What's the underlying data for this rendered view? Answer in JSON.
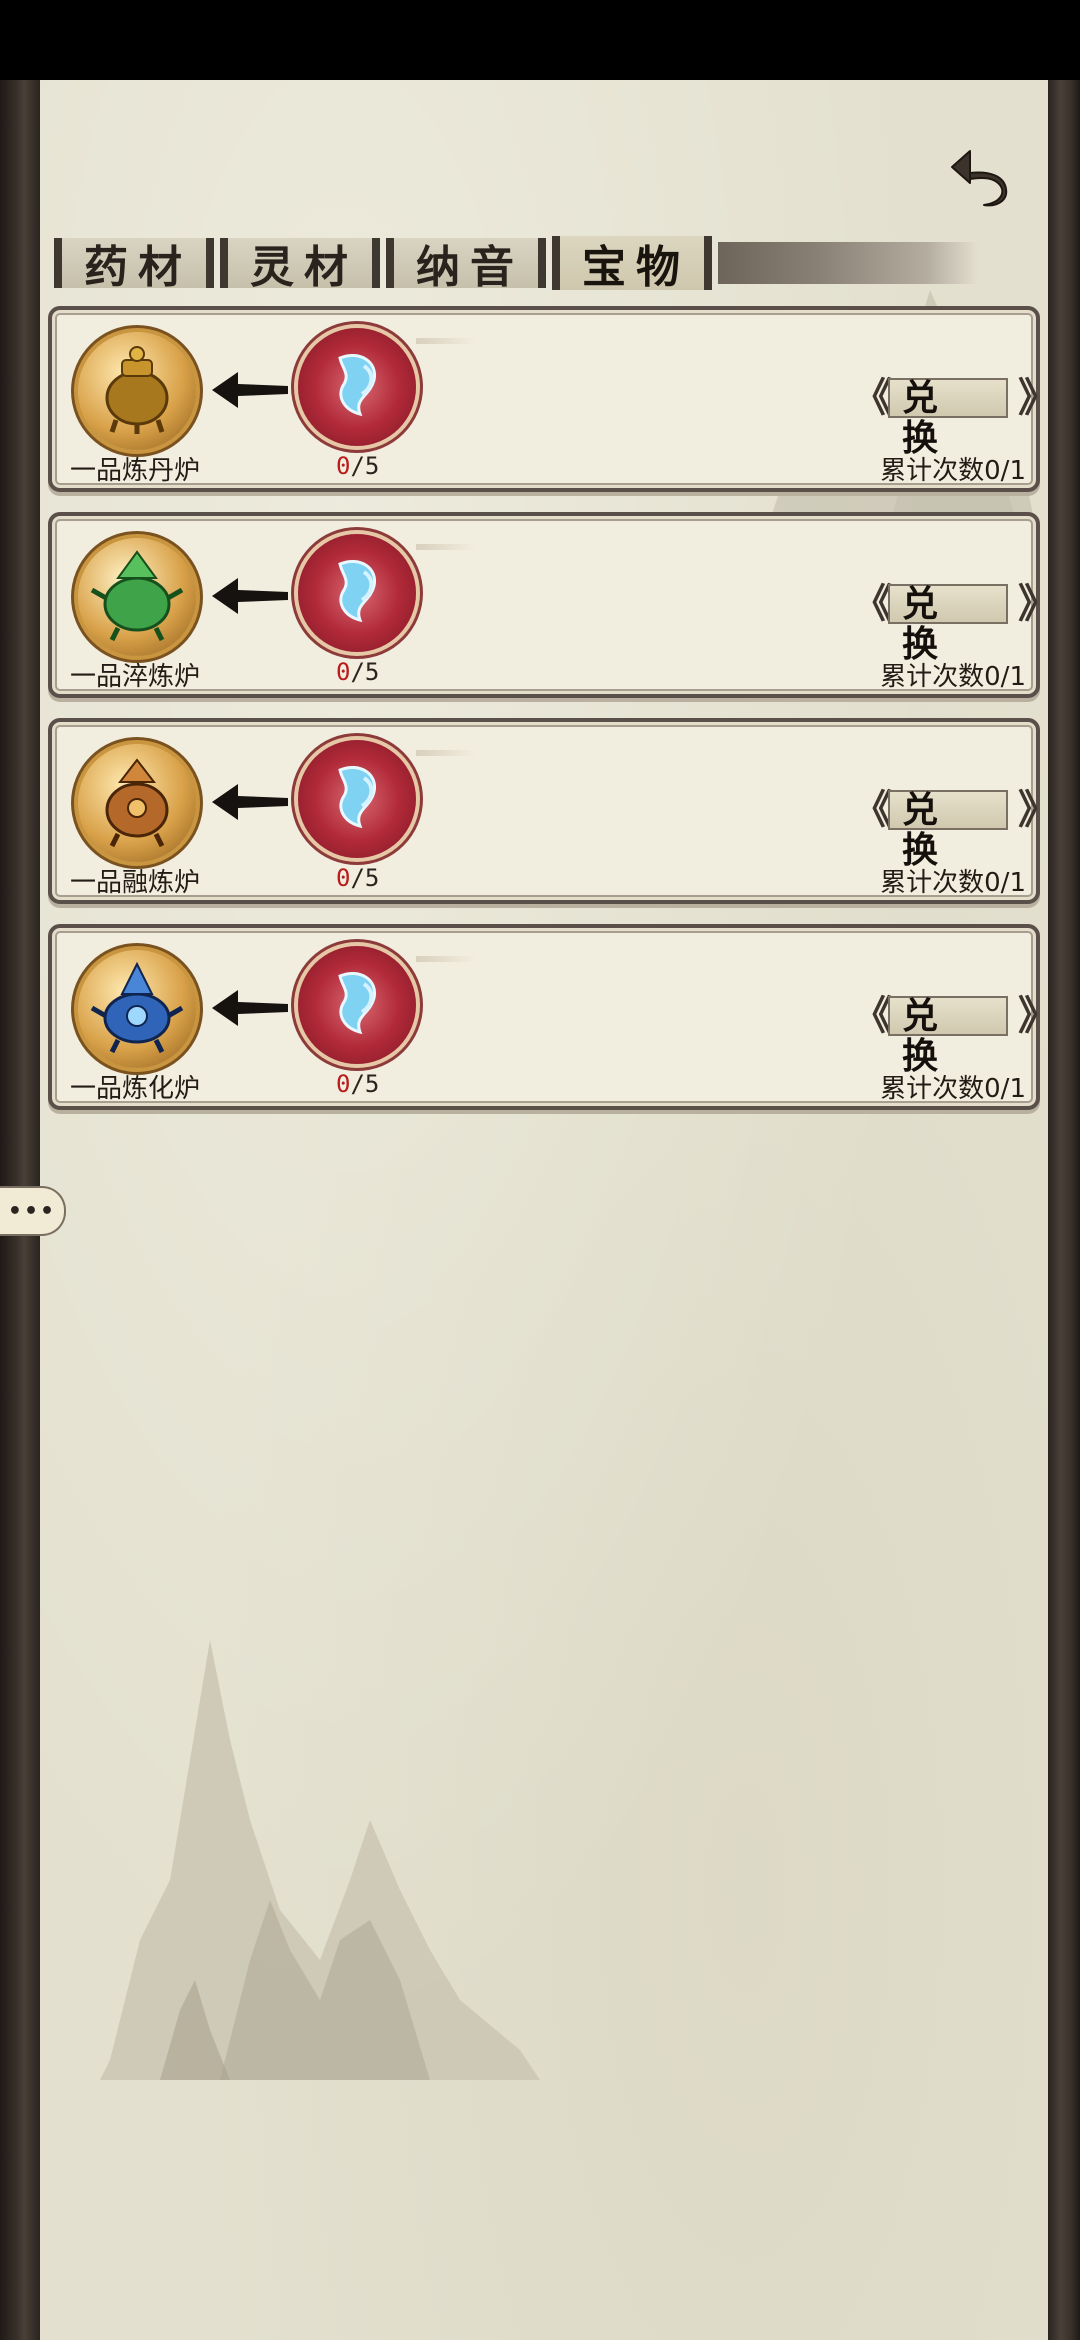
{
  "header": {
    "back_icon": "undo-arrow-icon"
  },
  "tabs": [
    {
      "label": "药材",
      "active": false
    },
    {
      "label": "灵材",
      "active": false
    },
    {
      "label": "纳音",
      "active": false
    },
    {
      "label": "宝物",
      "active": true
    }
  ],
  "items": [
    {
      "name": "一品炼丹炉",
      "icon": "gold-cauldron-icon",
      "progress_current": "0",
      "progress_total": "/5",
      "button": "兑换",
      "count_label": "累计次数0/1"
    },
    {
      "name": "一品淬炼炉",
      "icon": "green-cauldron-icon",
      "progress_current": "0",
      "progress_total": "/5",
      "button": "兑换",
      "count_label": "累计次数0/1"
    },
    {
      "name": "一品融炼炉",
      "icon": "bronze-cauldron-icon",
      "progress_current": "0",
      "progress_total": "/5",
      "button": "兑换",
      "count_label": "累计次数0/1"
    },
    {
      "name": "一品炼化炉",
      "icon": "blue-cauldron-icon",
      "progress_current": "0",
      "progress_total": "/5",
      "button": "兑换",
      "count_label": "累计次数0/1"
    }
  ],
  "currency_icon": "spirit-crystal-token-icon",
  "arrow_icon": "left-arrow-icon",
  "float_button": {
    "label": "•••",
    "icon": "more-dots-icon"
  },
  "colors": {
    "paper": "#e3e0cf",
    "card": "#f2eedf",
    "frame": "#3a322c",
    "progress_current": "#b81c1c",
    "token_red": "#b22a39"
  }
}
